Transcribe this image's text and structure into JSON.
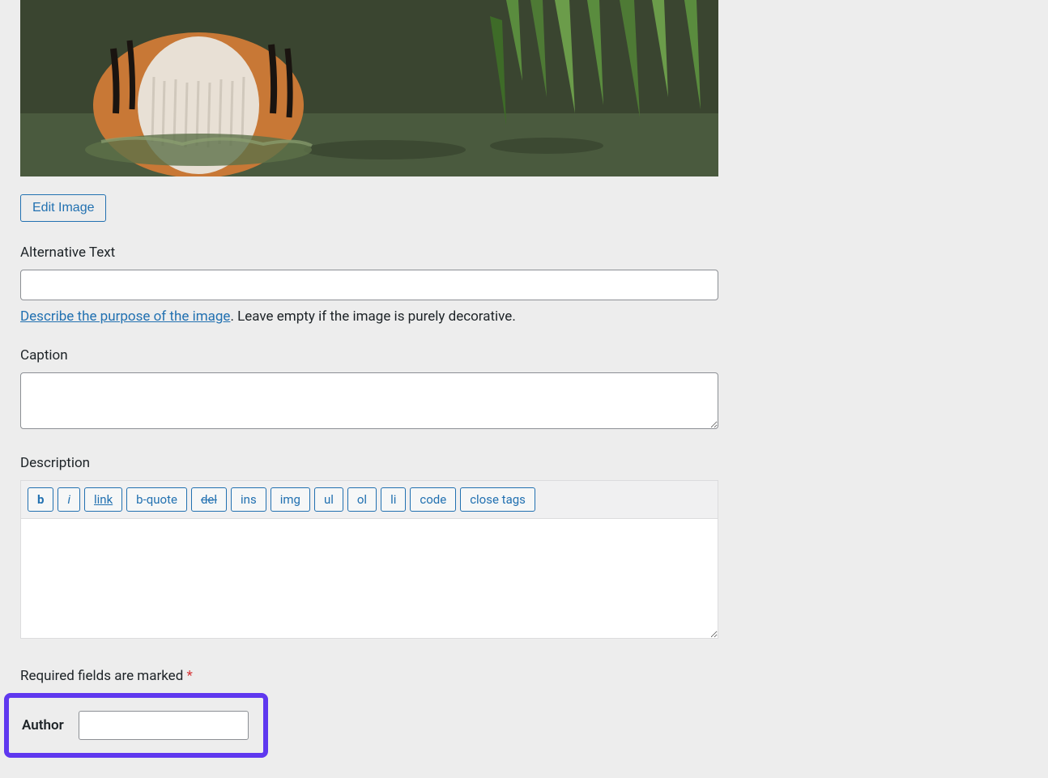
{
  "editImageButton": "Edit Image",
  "altText": {
    "label": "Alternative Text",
    "value": "",
    "helpLinkText": "Describe the purpose of the image",
    "helpTextSuffix": ". Leave empty if the image is purely decorative."
  },
  "caption": {
    "label": "Caption",
    "value": ""
  },
  "description": {
    "label": "Description",
    "value": "",
    "toolbar": {
      "bold": "b",
      "italic": "i",
      "link": "link",
      "bquote": "b-quote",
      "del": "del",
      "ins": "ins",
      "img": "img",
      "ul": "ul",
      "ol": "ol",
      "li": "li",
      "code": "code",
      "closeTags": "close tags"
    }
  },
  "requiredNote": "Required fields are marked ",
  "requiredAsterisk": "*",
  "author": {
    "label": "Author",
    "value": ""
  }
}
